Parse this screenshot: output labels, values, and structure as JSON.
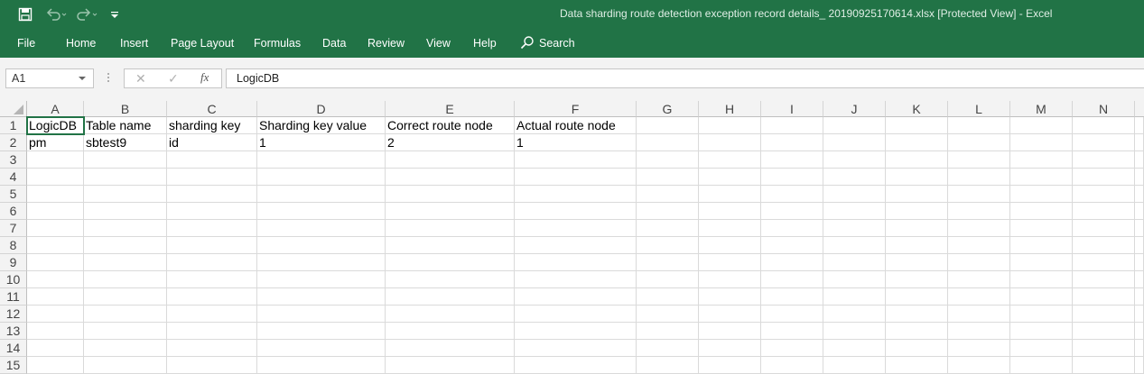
{
  "window": {
    "title": "Data sharding route detection exception record details_ 20190925170614.xlsx  [Protected View]  -  Excel",
    "accent_color": "#217346"
  },
  "quick_access": {
    "save_icon": "save-icon",
    "undo_icon": "undo-icon",
    "redo_icon": "redo-icon",
    "customize_icon": "customize-qat-icon"
  },
  "ribbon": {
    "tabs": [
      "File",
      "Home",
      "Insert",
      "Page Layout",
      "Formulas",
      "Data",
      "Review",
      "View",
      "Help"
    ],
    "search_label": "Search"
  },
  "formula_bar": {
    "name_box": "A1",
    "cancel_glyph": "✕",
    "enter_glyph": "✓",
    "fx_label": "fx",
    "formula": "LogicDB"
  },
  "sheet": {
    "columns": [
      "A",
      "B",
      "C",
      "D",
      "E",
      "F",
      "G",
      "H",
      "I",
      "J",
      "K",
      "L",
      "M",
      "N"
    ],
    "row_numbers": [
      "1",
      "2",
      "3",
      "4",
      "5",
      "6",
      "7",
      "8",
      "9",
      "10",
      "11",
      "12",
      "13",
      "14",
      "15"
    ],
    "rows": [
      [
        "LogicDB",
        "Table name",
        "sharding key",
        "Sharding key value",
        "Correct route node",
        "Actual route node"
      ],
      [
        "pm",
        "sbtest9",
        "id",
        "1",
        "2",
        "1"
      ]
    ]
  }
}
